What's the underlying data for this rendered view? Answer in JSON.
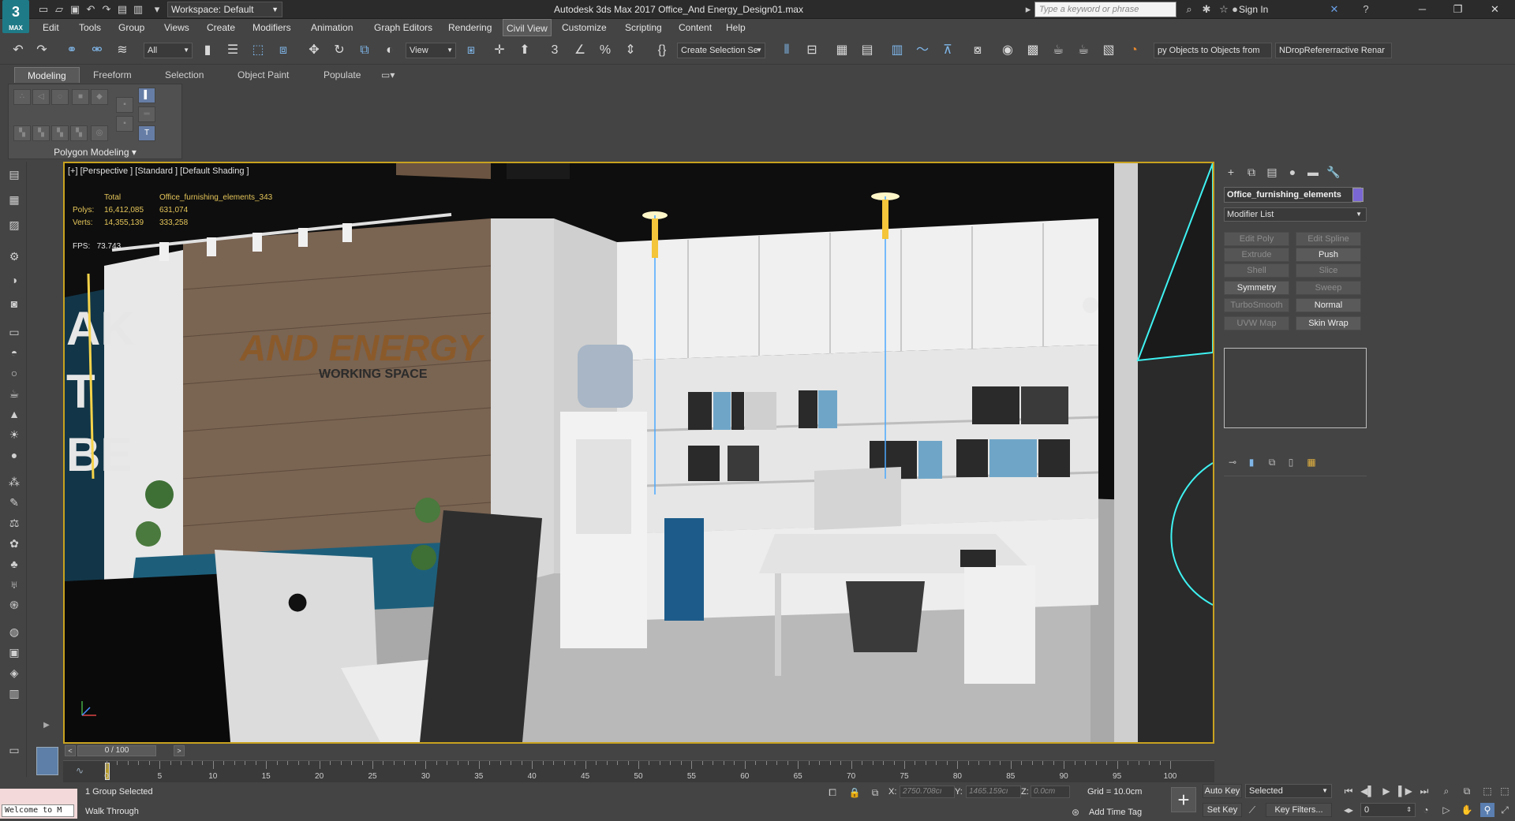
{
  "titlebar": {
    "app_logo": "3",
    "app_logo_sub": "MAX",
    "workspace": "Workspace: Default",
    "document_title": "Autodesk 3ds Max 2017    Office_And Energy_Design01.max",
    "search_placeholder": "Type a keyword or phrase",
    "sign_in": "Sign In"
  },
  "menubar": {
    "items": [
      "Edit",
      "Tools",
      "Group",
      "Views",
      "Create",
      "Modifiers",
      "Animation",
      "Graph Editors",
      "Rendering",
      "Civil View",
      "Customize",
      "Scripting",
      "Content",
      "Help"
    ],
    "active_index": 9
  },
  "toolbar": {
    "selection_filter": "All",
    "reference_coord": "View",
    "selection_set": "Create Selection Se",
    "script_button_1": "py Objects to  Objects from",
    "script_button_2": "NDropRefererractive Renar"
  },
  "ribbon": {
    "tabs": [
      "Modeling",
      "Freeform",
      "Selection",
      "Object Paint",
      "Populate"
    ],
    "active_tab": "Modeling",
    "panel_label": "Polygon Modeling"
  },
  "viewport": {
    "label": "[+] [Perspective ] [Standard ] [Default Shading ]",
    "stats_header_total": "Total",
    "stats_header_object": "Office_furnishing_elements_343",
    "polys_label": "Polys:",
    "polys_total": "16,412,085",
    "polys_object": "631,074",
    "verts_label": "Verts:",
    "verts_total": "14,355,139",
    "verts_object": "333,258",
    "fps_label": "FPS:",
    "fps_value": "73.743",
    "logo_line1": "AND ENERGY",
    "logo_line2": "WORKING SPACE"
  },
  "command_panel": {
    "object_name": "Office_furnishing_elements",
    "object_color": "#7b67d3",
    "modifier_list": "Modifier List",
    "modifiers": [
      {
        "label": "Edit Poly",
        "enabled": false
      },
      {
        "label": "Edit Spline",
        "enabled": false
      },
      {
        "label": "Extrude",
        "enabled": false
      },
      {
        "label": "Push",
        "enabled": true
      },
      {
        "label": "Shell",
        "enabled": false
      },
      {
        "label": "Slice",
        "enabled": false
      },
      {
        "label": "Symmetry",
        "enabled": true
      },
      {
        "label": "Sweep",
        "enabled": false
      },
      {
        "label": "TurboSmooth",
        "enabled": false
      },
      {
        "label": "Normal",
        "enabled": true
      },
      {
        "label": "UVW Map",
        "enabled": false
      },
      {
        "label": "Skin Wrap",
        "enabled": true
      }
    ]
  },
  "timeline": {
    "frame_display": "0 / 100",
    "ticks": [
      "0",
      "5",
      "10",
      "15",
      "20",
      "25",
      "30",
      "35",
      "40",
      "45",
      "50",
      "55",
      "60",
      "65",
      "70",
      "75",
      "80",
      "85",
      "90",
      "95",
      "100"
    ]
  },
  "statusbar": {
    "welcome": "Welcome to M",
    "selection_status": "1 Group Selected",
    "prompt": "Walk Through",
    "x_label": "X:",
    "x_value": "2750.708cı",
    "y_label": "Y:",
    "y_value": "1465.159cı",
    "z_label": "Z:",
    "z_value": "0.0cm",
    "grid": "Grid = 10.0cm",
    "add_time_tag": "Add Time Tag",
    "auto_key": "Auto Key",
    "set_key": "Set Key",
    "key_mode": "Selected",
    "key_filters": "Key Filters...",
    "current_frame": "0"
  }
}
